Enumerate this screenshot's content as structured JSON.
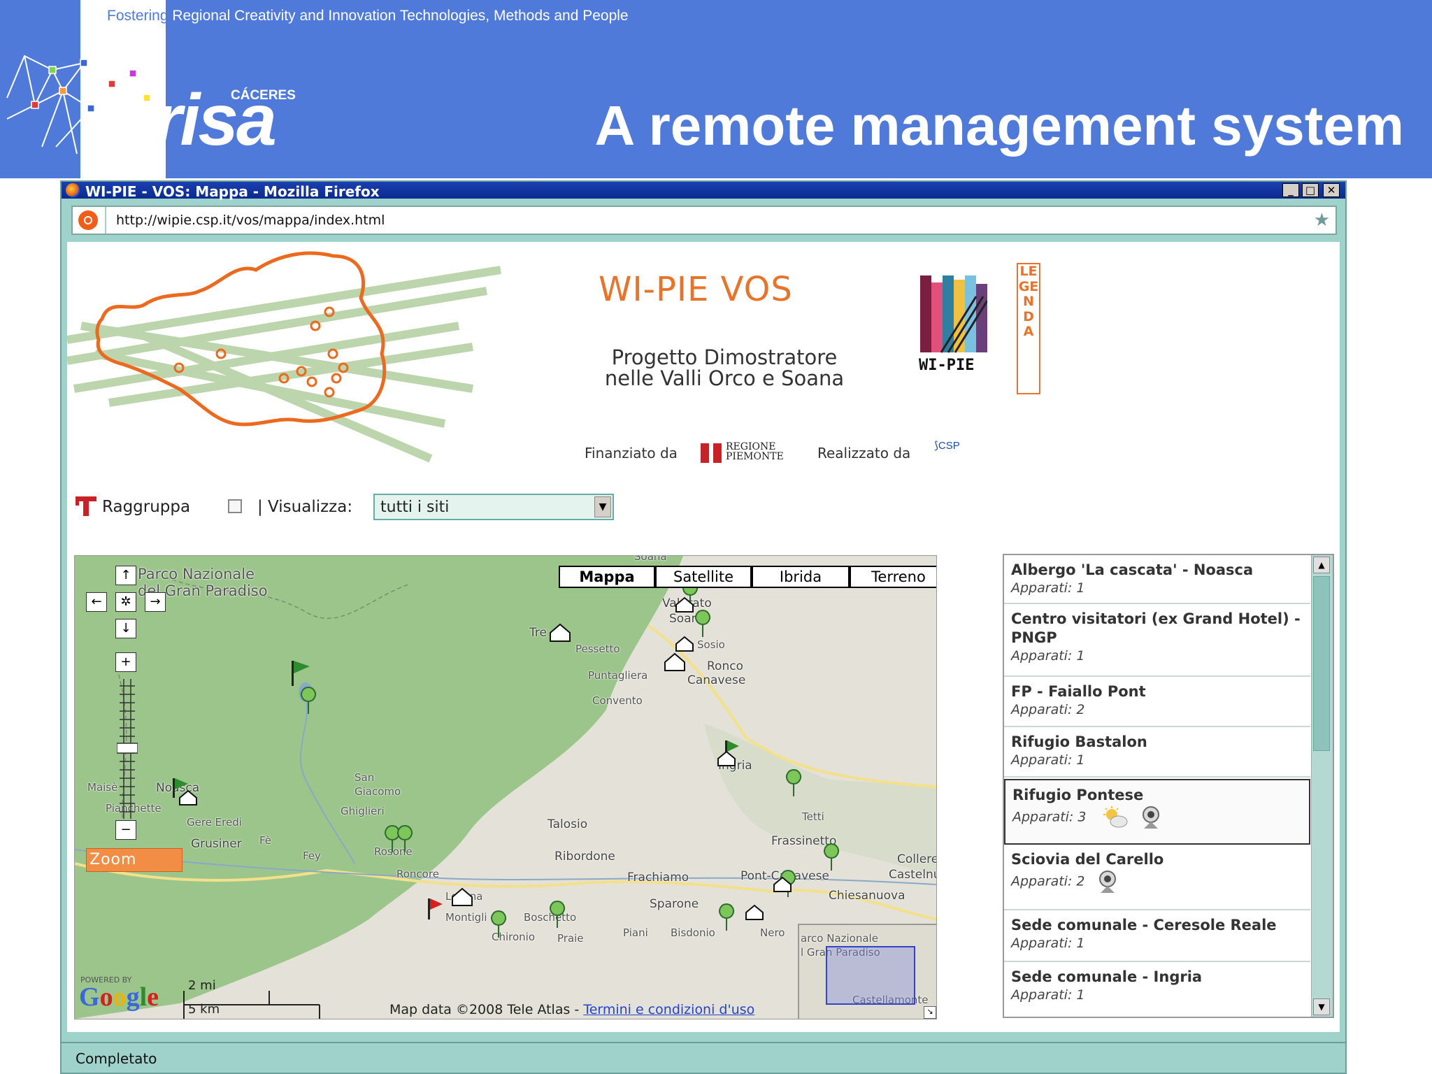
{
  "slide": {
    "tagline_lead": "Fostering",
    "tagline_rest": " Regional Creativity and Innovation Technologies, Methods and People",
    "logo_region": "CÁCERES",
    "logo_name": "erisa",
    "title": "A remote management system"
  },
  "window": {
    "title": "WI-PIE - VOS: Mappa - Mozilla Firefox",
    "url": "http://wipie.csp.it/vos/mappa/index.html",
    "status": "Completato",
    "controls": {
      "minimize": "_",
      "maximize": "□",
      "close": "✕"
    }
  },
  "page": {
    "app_title": "WI-PIE VOS",
    "subtitle_line1": "Progetto Dimostratore",
    "subtitle_line2": "nelle Valli Orco e Soana",
    "logo_text": "WI-PIE",
    "legenda": "LEGENDA",
    "funded_by_label": "Finanziato da",
    "funder_name": "REGIONE PIEMONTE",
    "made_by_label": "Realizzato da",
    "maker_name": "CSP"
  },
  "toolbar": {
    "group_label": "Raggruppa",
    "show_label": "| Visualizza:",
    "show_value": "tutti i siti",
    "group_checked": false
  },
  "map": {
    "types": [
      "Mappa",
      "Satellite",
      "Ibrida",
      "Terreno"
    ],
    "active_type": "Mappa",
    "zoom_label": "Zoom",
    "powered_by": "POWERED BY",
    "brand": "Google",
    "scale_imperial": "2 mi",
    "scale_metric": "5 km",
    "credit": "Map data ©2008 Tele Atlas - ",
    "credit_link": "Termini e condizioni d'uso",
    "overview_labels": [
      "arco Nazionale",
      "l Gran Paradiso",
      "Castellamonte"
    ],
    "place_labels": [
      "Parco Nazionale",
      "del Gran Paradiso",
      "Soana",
      "Valprato",
      "Soana",
      "Tre",
      "Pessetto",
      "Puntagliera",
      "Convento",
      "Sparone",
      "Ingria",
      "Pont-Canavese",
      "San",
      "Giacomo",
      "Ghiglieri",
      "Talosio",
      "Ribordone",
      "Frachiamo",
      "Gere Eredi",
      "Grusiner",
      "Fè",
      "Fey",
      "Rosone",
      "Roncore",
      "Locana",
      "Montigli",
      "Boschetto",
      "Chironio",
      "Praie",
      "Piani",
      "Bisdonio",
      "Sparone",
      "Nero",
      "Tetti",
      "Frassinetto",
      "Colleretto",
      "Castelnuovo",
      "Chiesanuova",
      "Maisè",
      "Noasca",
      "Pianchette",
      "Ronco",
      "Canavese",
      "Sosio"
    ],
    "colors": {
      "park": "#9bc58a",
      "land": "#e4e2d8",
      "river": "#8aa8c8",
      "road": "#f3e08a"
    }
  },
  "sites": [
    {
      "name": "Albergo 'La cascata' - Noasca",
      "count": "Apparati: 1",
      "icons": []
    },
    {
      "name": "Centro visitatori (ex Grand Hotel) - PNGP",
      "count": "Apparati: 1",
      "icons": []
    },
    {
      "name": "FP - Faiallo Pont",
      "count": "Apparati: 2",
      "icons": []
    },
    {
      "name": "Rifugio Bastalon",
      "count": "Apparati: 1",
      "icons": []
    },
    {
      "name": "Rifugio Pontese",
      "count": "Apparati: 3",
      "icons": [
        "weather-icon",
        "webcam-icon"
      ],
      "selected": true
    },
    {
      "name": "Sciovia del Carello",
      "count": "Apparati: 2",
      "icons": [
        "webcam-icon"
      ]
    },
    {
      "name": "Sede comunale - Ceresole Reale",
      "count": "Apparati: 1",
      "icons": []
    },
    {
      "name": "Sede comunale - Ingria",
      "count": "Apparati: 1",
      "icons": []
    }
  ],
  "colors": {
    "slide_blue": "#4f7ad9",
    "accent_orange": "#e8732a",
    "browser_teal": "#9fd2cb"
  }
}
